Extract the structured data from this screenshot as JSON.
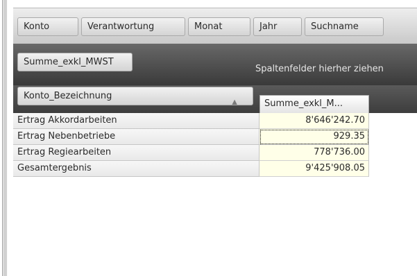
{
  "filter_fields": [
    "Konto",
    "Verantwortung",
    "Monat",
    "Jahr",
    "Suchname"
  ],
  "data_field": "Summe_exkl_MWST",
  "column_drop_hint": "Spaltenfelder hierher ziehen",
  "row_field": {
    "label": "Konto_Bezeichnung",
    "sort": "ascending"
  },
  "column_header": "Summe_exkl_M...",
  "rows": [
    {
      "label": "Ertrag Akkordarbeiten",
      "value": "8'646'242.70"
    },
    {
      "label": "Ertrag Nebenbetriebe",
      "value": "929.35"
    },
    {
      "label": "Ertrag Regiearbeiten",
      "value": "778'736.00"
    },
    {
      "label": "Gesamtergebnis",
      "value": "9'425'908.05"
    }
  ],
  "icons": {
    "sort": "sort-ascending-icon"
  },
  "colors": {
    "value_cell_bg": "#ffffe8",
    "dark_band": "#3a3a3a"
  }
}
